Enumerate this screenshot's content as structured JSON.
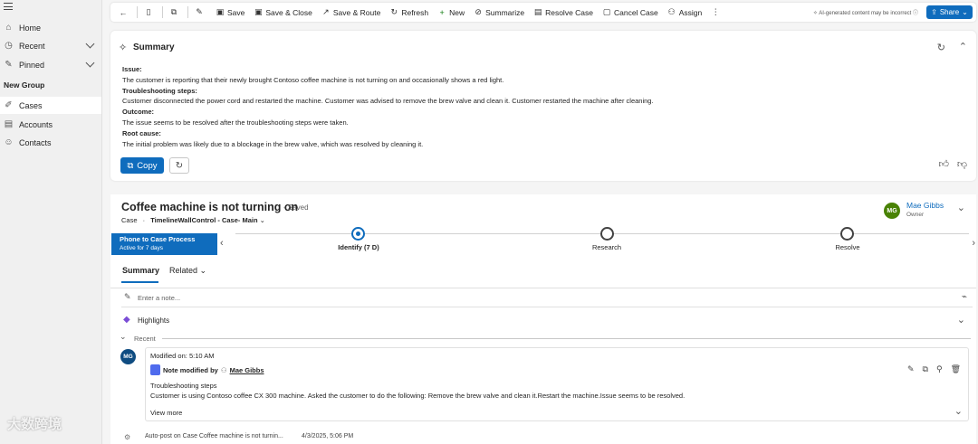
{
  "sidebar": {
    "items": [
      {
        "label": "Home",
        "icon": "home-icon"
      },
      {
        "label": "Recent",
        "icon": "clock-icon"
      },
      {
        "label": "Pinned",
        "icon": "pin-icon"
      }
    ],
    "group_label": "New Group",
    "group_items": [
      {
        "label": "Cases",
        "icon": "wrench-icon"
      },
      {
        "label": "Accounts",
        "icon": "building-icon"
      },
      {
        "label": "Contacts",
        "icon": "person-icon"
      }
    ]
  },
  "toolbar": {
    "save": "Save",
    "save_close": "Save & Close",
    "save_route": "Save & Route",
    "refresh": "Refresh",
    "new": "New",
    "summarize": "Summarize",
    "resolve_case": "Resolve Case",
    "cancel_case": "Cancel Case",
    "assign": "Assign",
    "ai_note": "AI-generated content may be incorrect",
    "share": "Share"
  },
  "summary": {
    "title": "Summary",
    "issue_label": "Issue:",
    "issue_text": "The customer is reporting that their newly brought Contoso coffee machine is not turning on and occasionally shows a red light.",
    "steps_label": "Troubleshooting steps:",
    "steps_text": "Customer disconnected the power cord and restarted the machine. Customer was advised to remove the brew valve and clean it. Customer restarted the machine after cleaning.",
    "outcome_label": "Outcome:",
    "outcome_text": "The issue seems to be resolved after the troubleshooting steps were taken.",
    "root_label": "Root cause:",
    "root_text": "The initial problem was likely due to a blockage in the brew valve, which was resolved by cleaning it.",
    "copy": "Copy"
  },
  "case": {
    "title": "Coffee machine is not turning on",
    "saved": "- Saved",
    "entity": "Case",
    "form": "TimelineWallControl - Case- Main",
    "owner_initials": "MG",
    "owner_name": "Mae Gibbs",
    "owner_role": "Owner"
  },
  "process": {
    "name": "Phone to Case Process",
    "active": "Active for 7 days",
    "stages": [
      {
        "label": "Identify  (7 D)",
        "active": true
      },
      {
        "label": "Research",
        "active": false
      },
      {
        "label": "Resolve",
        "active": false
      }
    ]
  },
  "tabs": {
    "summary": "Summary",
    "related": "Related"
  },
  "timeline": {
    "note_placeholder": "Enter a note...",
    "highlights": "Highlights",
    "recent": "Recent",
    "entry": {
      "initials": "MG",
      "modified": "Modified on: 5:10 AM",
      "modified_by": "Note modified by",
      "author": "Mae Gibbs",
      "title": "Troubleshooting steps",
      "text": "Customer is using Contoso coffee CX 300 machine. Asked the customer to do the following: Remove the brew valve and clean it.Restart  the machine.Issue seems to be resolved.",
      "view_more": "View more"
    },
    "autopost": "Auto-post on Case Coffee machine is not turnin...",
    "autopost_date": "4/3/2025, 5:06 PM"
  },
  "watermark": "大数跨境",
  "colors": {
    "accent": "#0f6cbd",
    "owner_avatar": "#498205"
  }
}
